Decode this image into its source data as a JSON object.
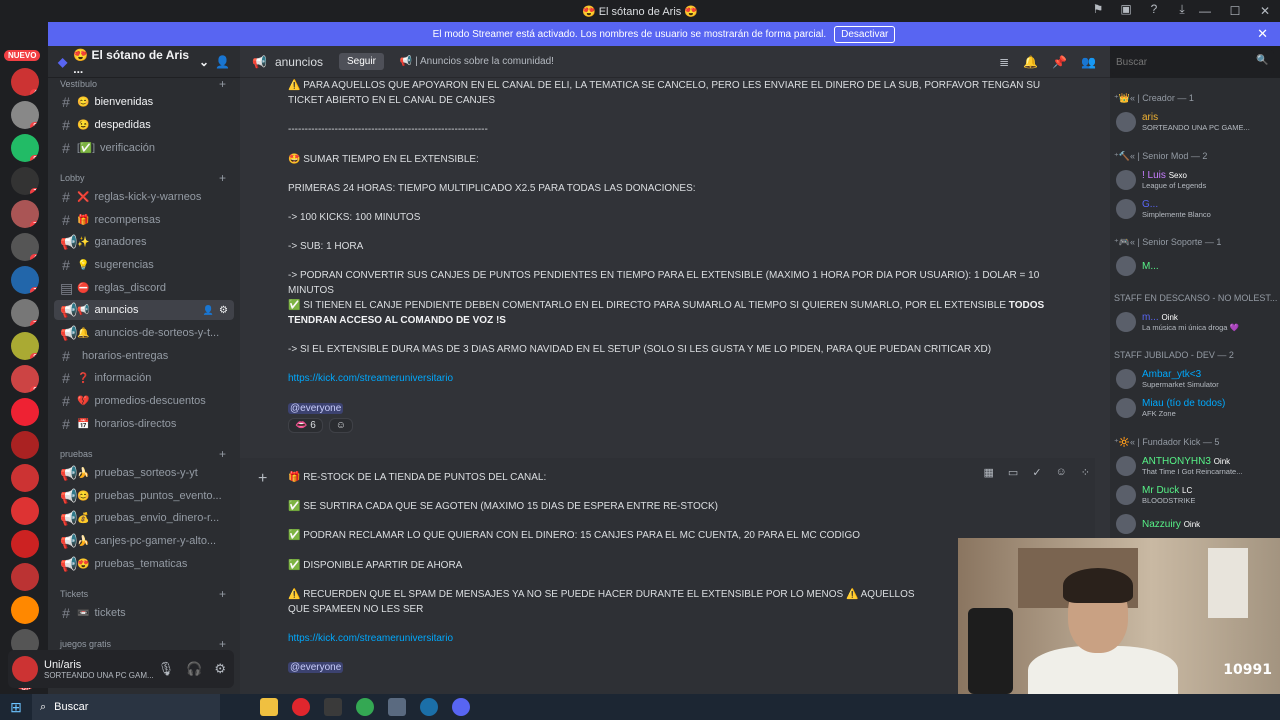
{
  "window": {
    "title": "😍 El sótano de Aris 😍",
    "controls": [
      "—",
      "☐",
      "✕"
    ]
  },
  "banner": {
    "text": "El modo Streamer está activado. Los nombres de usuario se mostrarán de forma parcial.",
    "button": "Desactivar"
  },
  "servers": {
    "new_badge": "NUEVO",
    "badges": [
      "4",
      "8",
      "8",
      "1",
      "2",
      "4",
      "1",
      "2",
      "8",
      "8",
      "",
      "",
      "",
      "",
      "",
      "",
      "",
      "2",
      "6K+"
    ]
  },
  "server": {
    "name": "😍 El sótano de Aris ..."
  },
  "channel_categories": [
    {
      "label": "Vestíbulo"
    },
    {
      "label": "Lobby"
    },
    {
      "label": "pruebas"
    },
    {
      "label": "Tickets"
    },
    {
      "label": "juegos gratis"
    }
  ],
  "channels": [
    {
      "label": "bienvenidas",
      "emoji": "😊"
    },
    {
      "label": "despedidas",
      "emoji": "😉"
    },
    {
      "label": "verificación",
      "emoji": "[✅]"
    },
    {
      "label": "reglas-kick-y-warneos",
      "emoji": "❌"
    },
    {
      "label": "recompensas",
      "emoji": "🎁"
    },
    {
      "label": "ganadores",
      "emoji": "✨"
    },
    {
      "label": "sugerencias",
      "emoji": "💡"
    },
    {
      "label": "reglas_discord",
      "emoji": "⛔"
    },
    {
      "label": "anuncios",
      "emoji": "📢"
    },
    {
      "label": "anuncios-de-sorteos-y-t...",
      "emoji": "🔔"
    },
    {
      "label": "horarios-entregas",
      "emoji": ""
    },
    {
      "label": "información",
      "emoji": "❓"
    },
    {
      "label": "promedios-descuentos",
      "emoji": "💔"
    },
    {
      "label": "horarios-directos",
      "emoji": "📅"
    },
    {
      "label": "pruebas_sorteos-y-yt",
      "emoji": "🍌"
    },
    {
      "label": "pruebas_puntos_evento...",
      "emoji": "😊"
    },
    {
      "label": "pruebas_envio_dinero-r...",
      "emoji": "💰"
    },
    {
      "label": "canjes-pc-gamer-y-alto...",
      "emoji": "🍌"
    },
    {
      "label": "pruebas_tematicas",
      "emoji": "😍"
    },
    {
      "label": "tickets",
      "emoji": "📼"
    }
  ],
  "user_panel": {
    "name": "Uni/aris",
    "status": "SORTEANDO UNA PC GAM..."
  },
  "channel_header": {
    "name": "anuncios",
    "follow": "Seguir",
    "topic": "📢 | Anuncios sobre la comunidad!"
  },
  "search": {
    "placeholder": "Buscar"
  },
  "messages": {
    "m1_line1": "⚠️ PARA AQUELLOS QUE APOYARON EN EL CANAL DE ELI, LA TEMATICA SE CANCELO, PERO LES ENVIARE EL DINERO DE LA SUB, PORFAVOR TENGAN SU TICKET ABIERTO EN EL CANAL DE CANJES",
    "m1_sep": "------------------------------------------------------------",
    "m1_title": "🤩 SUMAR TIEMPO EN EL EXTENSIBLE:",
    "m1_p1": "PRIMERAS 24 HORAS: TIEMPO MULTIPLICADO X2.5 PARA TODAS LAS DONACIONES:",
    "m1_p2": "-> 100 KICKS: 100 MINUTOS",
    "m1_p3": "-> SUB: 1 HORA",
    "m1_p4": "-> PODRAN CONVERTIR SUS CANJES DE PUNTOS PENDIENTES EN TIEMPO PARA EL EXTENSIBLE (MAXIMO 1 HORA POR DIA POR USUARIO): 1 DOLAR = 10 MINUTOS",
    "m1_p5a": "✅ SI TIENEN EL CANJE PENDIENTE DEBEN COMENTARLO EN EL DIRECTO PARA SUMARLO AL TIEMPO SI QUIEREN SUMARLO, POR EL EXTENSIBLE ",
    "m1_p5b": "TODOS TENDRAN ACCESO AL COMANDO DE VOZ !S",
    "m1_p6": "-> SI EL EXTENSIBLE DURA MAS DE 3 DIAS ARMO NAVIDAD EN EL SETUP (SOLO SI LES GUSTA Y ME LO PIDEN, PARA QUE PUEDAN CRITICAR XD)",
    "m1_link": "https://kick.com/streameruniversitario",
    "m1_mention": "@everyone",
    "m1_reaction": "6",
    "m2_title": "🎁 RE-STOCK DE LA TIENDA DE PUNTOS DEL CANAL:",
    "m2_p1": "✅ SE SURTIRA CADA QUE SE AGOTEN (MAXIMO 15 DIAS DE ESPERA ENTRE RE-STOCK)",
    "m2_p2": "✅ PODRAN RECLAMAR LO QUE QUIERAN CON EL DINERO: 15 CANJES PARA EL MC CUENTA, 20 PARA EL MC CODIGO",
    "m2_p3": "✅ DISPONIBLE APARTIR DE AHORA",
    "m2_p4": "⚠️ RECUERDEN QUE EL SPAM DE MENSAJES YA NO SE PUEDE HACER DURANTE EL EXTENSIBLE POR LO MENOS ⚠️ AQUELLOS QUE SPAMEEN NO LES SER",
    "m2_link": "https://kick.com/streameruniversitario",
    "m2_mention": "@everyone"
  },
  "members": {
    "cat_creador": "⁺👑« | Creador — 1",
    "creador": [
      {
        "name": "aris",
        "status": "SORTEANDO UNA PC GAME...",
        "color": "#f0b232"
      }
    ],
    "cat_mod": "⁺🔨« | Senior Mod — 2",
    "mods": [
      {
        "name": "! Luis",
        "tag": "Sexo",
        "status": "League of Legends",
        "color": "#c77dff"
      },
      {
        "name": "G...",
        "status": "Simplemente Blanco",
        "color": "#5865f2"
      }
    ],
    "cat_soporte": "⁺🎮« | Senior Soporte — 1",
    "soporte": [
      {
        "name": "M...",
        "color": "#57f287"
      }
    ],
    "cat_descanso": "STAFF EN DESCANSO - NO MOLEST...",
    "descanso": [
      {
        "name": "m...",
        "tag": "Oink",
        "status": "La música mi única droga 💜",
        "color": "#5865f2"
      }
    ],
    "cat_jubilado": "STAFF JUBILADO - DEV — 2",
    "jubilado": [
      {
        "name": "Ambar_ytk<3",
        "status": "Supermarket Simulator",
        "color": "#00a8fc"
      },
      {
        "name": "Miau (tío de todos)",
        "status": "AFK Zone",
        "color": "#00a8fc"
      }
    ],
    "cat_fundador": "⁺🔆« | Fundador Kick — 5",
    "fundador": [
      {
        "name": "ANTHONYHN3",
        "tag": "Oink",
        "status": "That Time I Got Reincarnate...",
        "color": "#57f287"
      },
      {
        "name": "Mr Duck",
        "tag": "LC",
        "status": "BLOODSTRIKE",
        "color": "#57f287"
      },
      {
        "name": "Nazzuiry",
        "tag": "Oink",
        "color": "#57f287"
      }
    ]
  },
  "webcam": {
    "overlay_number": "10991"
  },
  "taskbar": {
    "search_label": "Buscar"
  }
}
